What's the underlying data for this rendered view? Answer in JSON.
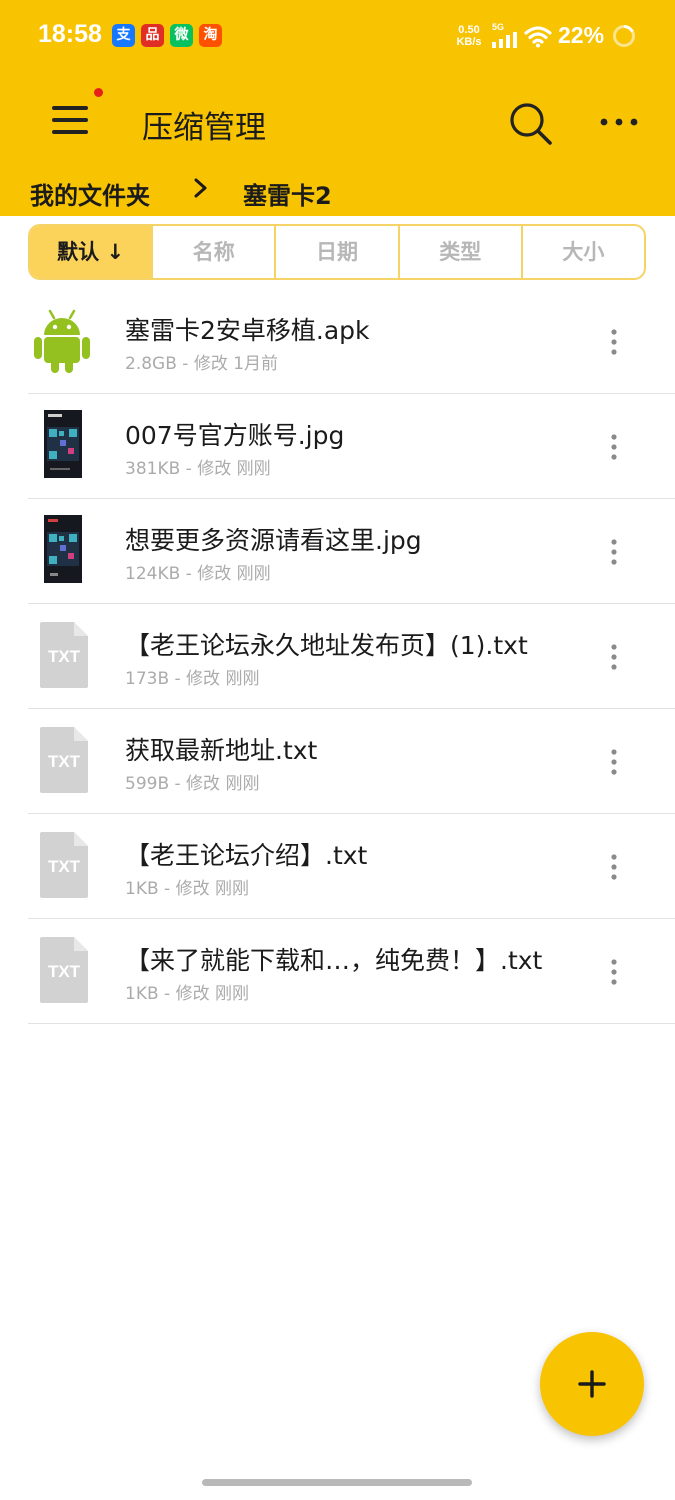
{
  "colors": {
    "accent": "#f8c300",
    "sort_selected": "#fbd35a",
    "sort_border": "#f5d366",
    "android": "#94c11f",
    "txt_icon": "#d2d2d2"
  },
  "status_bar": {
    "time": "18:58",
    "apps": [
      {
        "icon": "alipay-icon",
        "glyph": "支",
        "color": "#1677ff"
      },
      {
        "icon": "pinduoduo-icon",
        "glyph": "品",
        "color": "#e02e24"
      },
      {
        "icon": "wechat-icon",
        "glyph": "微",
        "color": "#07c160"
      },
      {
        "icon": "taobao-icon",
        "glyph": "淘",
        "color": "#ff5000"
      }
    ],
    "net_speed_value": "0.50",
    "net_speed_unit": "KB/s",
    "network_type": "5G",
    "battery": "22%"
  },
  "header": {
    "title": "压缩管理",
    "breadcrumb": [
      "我的文件夹",
      "塞雷卡2"
    ]
  },
  "sort_tabs": [
    {
      "label": "默认 ↓",
      "selected": true
    },
    {
      "label": "名称",
      "selected": false
    },
    {
      "label": "日期",
      "selected": false
    },
    {
      "label": "类型",
      "selected": false
    },
    {
      "label": "大小",
      "selected": false
    }
  ],
  "files": [
    {
      "name": "塞雷卡2安卓移植.apk",
      "meta": "2.8GB - 修改 1月前",
      "icon": "android-icon"
    },
    {
      "name": "007号官方账号.jpg",
      "meta": "381KB - 修改 刚刚",
      "icon": "image-thumbnail"
    },
    {
      "name": "想要更多资源请看这里.jpg",
      "meta": "124KB - 修改 刚刚",
      "icon": "image-thumbnail"
    },
    {
      "name": "【老王论坛永久地址发布页】(1).txt",
      "meta": "173B - 修改 刚刚",
      "icon": "txt-file-icon"
    },
    {
      "name": "获取最新地址.txt",
      "meta": "599B - 修改 刚刚",
      "icon": "txt-file-icon"
    },
    {
      "name": "【老王论坛介绍】.txt",
      "meta": "1KB - 修改 刚刚",
      "icon": "txt-file-icon"
    },
    {
      "name": "【来了就能下载和…，纯免费！】.txt",
      "meta": "1KB - 修改 刚刚",
      "icon": "txt-file-icon"
    }
  ],
  "txt_icon_label": "TXT",
  "fab": {
    "icon": "plus-icon"
  }
}
